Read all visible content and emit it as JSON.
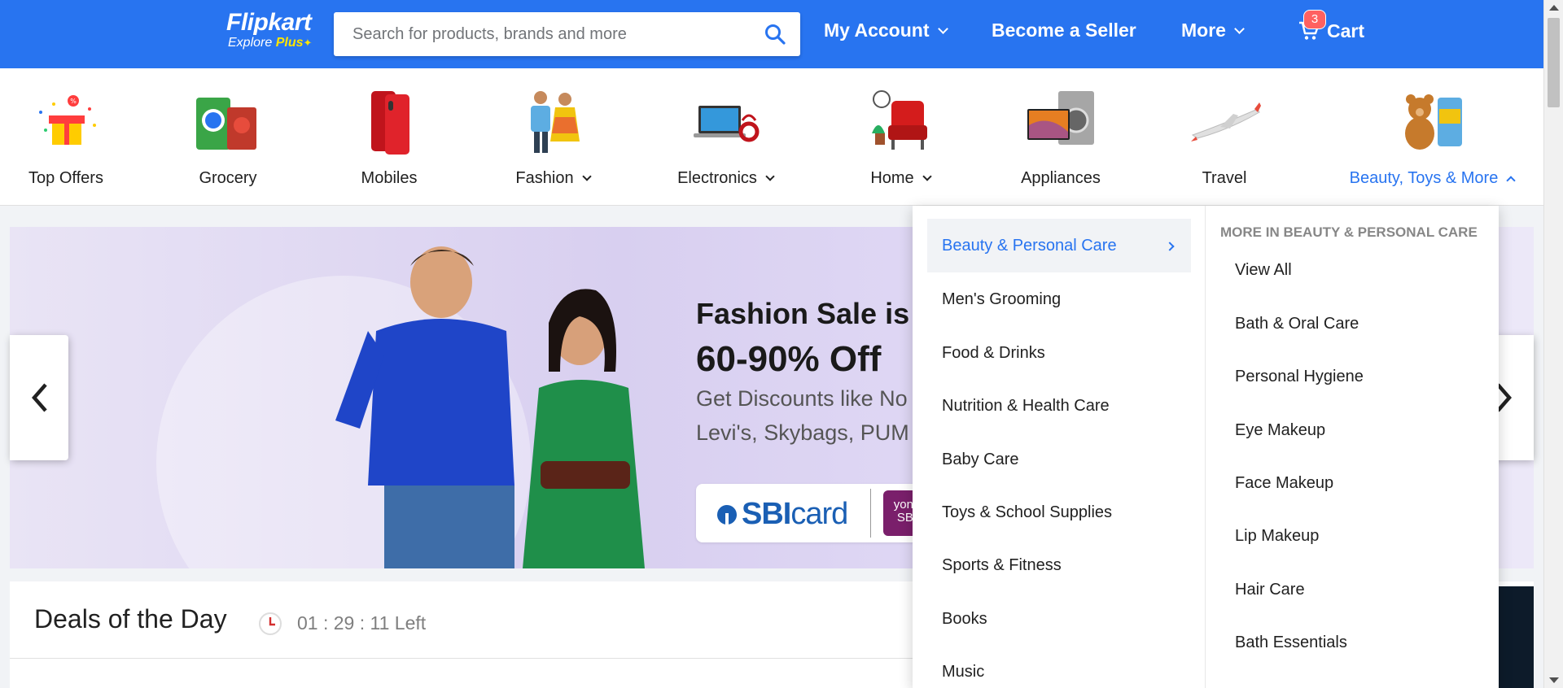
{
  "header": {
    "logo": "Flipkart",
    "logo_sub": "Explore",
    "logo_plus": "Plus",
    "search_placeholder": "Search for products, brands and more",
    "my_account": "My Account",
    "become_seller": "Become a Seller",
    "more": "More",
    "cart": "Cart",
    "cart_count": "3"
  },
  "categories": [
    {
      "label": "Top Offers",
      "icon": "gift-icon"
    },
    {
      "label": "Grocery",
      "icon": "grocery-icon"
    },
    {
      "label": "Mobiles",
      "icon": "mobile-icon"
    },
    {
      "label": "Fashion",
      "icon": "fashion-icon"
    },
    {
      "label": "Electronics",
      "icon": "laptop-icon"
    },
    {
      "label": "Home",
      "icon": "armchair-icon"
    },
    {
      "label": "Appliances",
      "icon": "tv-washer-icon"
    },
    {
      "label": "Travel",
      "icon": "airplane-icon"
    },
    {
      "label": "Beauty, Toys & More",
      "icon": "teddy-bear-icon"
    }
  ],
  "banner": {
    "title": "Fashion Sale is",
    "offer": "60-90% Off",
    "desc_line1": "Get Discounts like No",
    "desc_line2": "Levi's, Skybags, PUM",
    "bank_name": "SBI",
    "bank_card": "card",
    "yono_line1": "yono",
    "yono_line2": "SBI"
  },
  "deals": {
    "title": "Deals of the Day",
    "timer": "01 : 29 : 11 Left"
  },
  "dropdown": {
    "categories": [
      "Beauty & Personal Care",
      "Men's Grooming",
      "Food & Drinks",
      "Nutrition & Health Care",
      "Baby Care",
      "Toys & School Supplies",
      "Sports & Fitness",
      "Books",
      "Music"
    ],
    "heading": "MORE IN BEAUTY & PERSONAL CARE",
    "subitems": [
      "View All",
      "Bath & Oral Care",
      "Personal Hygiene",
      "Eye Makeup",
      "Face Makeup",
      "Lip Makeup",
      "Hair Care",
      "Bath Essentials"
    ]
  },
  "colors": {
    "brand_blue": "#2874f0",
    "accent_yellow": "#ffe500",
    "badge_red": "#ff6161"
  }
}
